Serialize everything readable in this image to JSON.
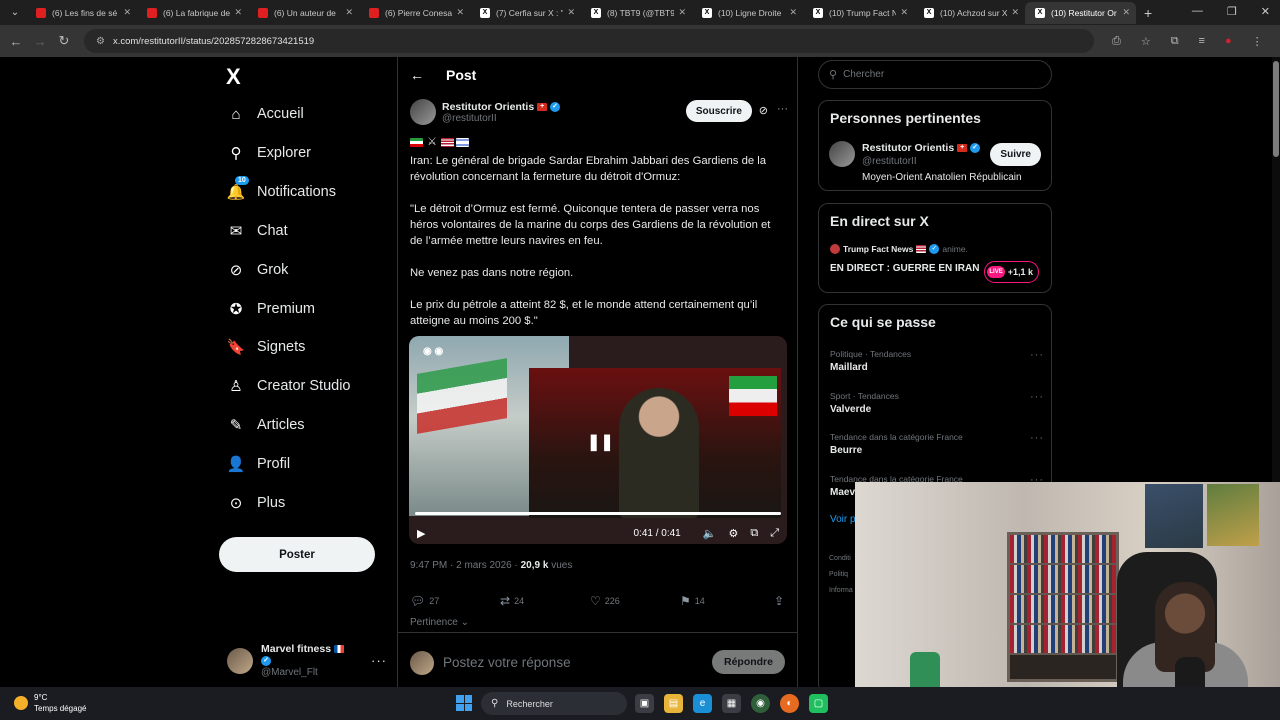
{
  "browser": {
    "tabs": [
      {
        "label": "(6) Les fins de sé",
        "kind": "yt"
      },
      {
        "label": "(6) La fabrique de",
        "kind": "yt"
      },
      {
        "label": "(6) Un auteur de",
        "kind": "yt"
      },
      {
        "label": "(6) Pierre Conesa",
        "kind": "yt"
      },
      {
        "label": "(7) Cerfia sur X : \"",
        "kind": "x"
      },
      {
        "label": "(8) TBT9 (@TBT9",
        "kind": "x"
      },
      {
        "label": "(10) Ligne Droite",
        "kind": "x"
      },
      {
        "label": "(10) Trump Fact N",
        "kind": "x"
      },
      {
        "label": "(10) Achzod sur X",
        "kind": "x"
      },
      {
        "label": "(10) Restitutor Or",
        "kind": "x",
        "active": true
      }
    ],
    "url": "x.com/restitutorII/status/2028572828673421519"
  },
  "sidebar": {
    "logo": "X",
    "items": [
      {
        "label": "Accueil",
        "icon": "home-icon",
        "glyph": "⌂"
      },
      {
        "label": "Explorer",
        "icon": "search-icon",
        "glyph": "⚲"
      },
      {
        "label": "Notifications",
        "icon": "bell-icon",
        "glyph": "🔔",
        "badge": "10"
      },
      {
        "label": "Chat",
        "icon": "mail-icon",
        "glyph": "✉"
      },
      {
        "label": "Grok",
        "icon": "grok-icon",
        "glyph": "⊘"
      },
      {
        "label": "Premium",
        "icon": "premium-icon",
        "glyph": "✪"
      },
      {
        "label": "Signets",
        "icon": "bookmark-icon",
        "glyph": "🔖"
      },
      {
        "label": "Creator Studio",
        "icon": "creator-studio-icon",
        "glyph": "♙"
      },
      {
        "label": "Articles",
        "icon": "articles-icon",
        "glyph": "✎"
      },
      {
        "label": "Profil",
        "icon": "profile-icon",
        "glyph": "👤"
      },
      {
        "label": "Plus",
        "icon": "more-circle-icon",
        "glyph": "⊙"
      }
    ],
    "post_button": "Poster",
    "account": {
      "name": "Marvel fitness",
      "handle": "@Marvel_Flt"
    }
  },
  "main": {
    "header_title": "Post",
    "author": {
      "name": "Restitutor Orientis",
      "handle": "@restitutorII"
    },
    "subscribe_label": "Souscrire",
    "paragraphs": [
      "Iran: Le général de brigade Sardar Ebrahim Jabbari des Gardiens de la révolution concernant la fermeture du détroit d'Ormuz:",
      "\"Le détroit d’Ormuz est fermé. Quiconque tentera de passer verra nos héros volontaires de la marine du corps des Gardiens de la révolution et de l’armée mettre leurs navires en feu.",
      "Ne venez pas dans notre région.",
      "Le prix du pétrole a atteint 82 $, et le monde attend certainement qu’il atteigne au moins 200 $.\""
    ],
    "video": {
      "time": "0:41 / 0:41",
      "progress": 1.0
    },
    "meta": {
      "time_date": "9:47 PM · 2 mars 2026 · ",
      "views": "20,9 k",
      "views_label": " vues"
    },
    "actions": {
      "replies": "27",
      "reposts": "24",
      "likes": "226",
      "bookmarks": "14"
    },
    "pertinence": "Pertinence",
    "reply_placeholder": "Postez votre réponse",
    "reply_button": "Répondre"
  },
  "right": {
    "search_placeholder": "Chercher",
    "relevant": {
      "title": "Personnes pertinentes",
      "name": "Restitutor Orientis",
      "handle": "@restitutorII",
      "bio": "Moyen-Orient Anatolien Républicain",
      "follow_label": "Suivre"
    },
    "live": {
      "title": "En direct sur X",
      "source": "Trump Fact News",
      "source_status": "anime.",
      "headline": "EN DIRECT : GUERRE EN IRAN",
      "live_tag": "LIVE",
      "listeners": "+1,1 k"
    },
    "trends": {
      "title": "Ce qui se passe",
      "items": [
        {
          "category": "Politique · Tendances",
          "name": "Maillard"
        },
        {
          "category": "Sport · Tendances",
          "name": "Valverde"
        },
        {
          "category": "Tendance dans la catégorie France",
          "name": "Beurre"
        },
        {
          "category": "Tendance dans la catégorie France",
          "name": "Maev"
        }
      ],
      "see_more": "Voir p"
    },
    "footer": [
      "Conditi",
      "Politiq",
      "Informa"
    ]
  },
  "taskbar": {
    "temperature": "9°C",
    "weather_text": "Temps dégagé",
    "search_label": "Rechercher"
  },
  "colors": {
    "accent": "#1d9bf0",
    "background": "#000000",
    "border": "#2f3336",
    "muted": "#71767b"
  }
}
